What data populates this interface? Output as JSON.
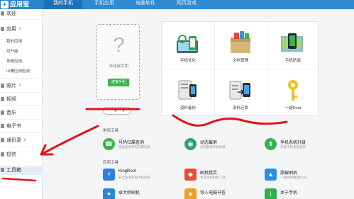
{
  "app": {
    "title": "应用宝"
  },
  "tabs": [
    {
      "label": "我的手机",
      "active": true
    },
    {
      "label": "手机应用",
      "active": false
    },
    {
      "label": "电脑软件",
      "active": false
    },
    {
      "label": "网页游戏",
      "active": false
    }
  ],
  "sidebar": {
    "welcome": "欢迎",
    "apps": {
      "label": "应用",
      "arrow": "∨",
      "subs": [
        "我的应用",
        "可升级",
        "系统应用",
        "山寨应用检测"
      ]
    },
    "photos": {
      "label": "照片",
      "arrow": "∨"
    },
    "video": {
      "label": "视频"
    },
    "music": {
      "label": "音乐"
    },
    "ebook": {
      "label": "电子书"
    },
    "contacts": {
      "label": "通讯录",
      "arrow": "∨"
    },
    "sms": {
      "label": "短信"
    },
    "toolbox": {
      "label": "工具箱"
    }
  },
  "phone_connect": {
    "icon": "?",
    "text": "未连接手机",
    "button": "连接手机"
  },
  "add_control": {
    "plus": "+",
    "caret": "▾"
  },
  "tools": [
    {
      "label": "手机优化",
      "icon": "phone-optimize-icon"
    },
    {
      "label": "文件管理",
      "icon": "file-manager-icon"
    },
    {
      "label": "手机防盗",
      "icon": "phone-antitheft-icon"
    },
    {
      "label": "资料备份",
      "icon": "data-backup-icon"
    },
    {
      "label": "资料还原",
      "icon": "data-restore-icon"
    },
    {
      "label": "一键Root",
      "icon": "key-root-icon"
    }
  ],
  "common_tools": {
    "title": "常用工具",
    "items": [
      {
        "name": "号码归属查询",
        "desc": "快速查询号码归属信息",
        "color": "#3bb54a",
        "icon": "phone-lookup-icon",
        "glyph": "☎"
      },
      {
        "name": "动态截屏",
        "desc": "实时截取手机屏幕",
        "color": "#2fa36b",
        "icon": "screenshot-icon",
        "glyph": "◉"
      },
      {
        "name": "手机系统升级",
        "desc": "升级手机系统固件",
        "color": "#35b34a",
        "icon": "system-upgrade-icon",
        "glyph": "⬆"
      }
    ]
  },
  "app_tools": {
    "title": "应用工具",
    "items": [
      {
        "name": "KingRoot",
        "desc": "安全快速获取手机权限",
        "color": "#2f7fd9",
        "icon": "kingroot-icon",
        "glyph": "⚡"
      },
      {
        "name": "刷机精灵",
        "desc": "专业手机刷机工具",
        "color": "#e84b3a",
        "icon": "flash-wizard-icon",
        "glyph": "◆"
      },
      {
        "name": "甜椒刷机",
        "desc": "一键刷机精品ROM",
        "color": "#2b8fe0",
        "icon": "tianjiao-icon",
        "glyph": "▲"
      },
      {
        "name": "卓大师刷机",
        "desc": "",
        "color": "#2a87d8",
        "icon": "zhuodashi-icon",
        "glyph": "✦"
      },
      {
        "name": "导入电脑书签",
        "desc": "",
        "color": "#f0a020",
        "icon": "bookmark-import-icon",
        "glyph": "★"
      },
      {
        "name": "关于手机",
        "desc": "",
        "color": "#2bb24c",
        "icon": "about-phone-icon",
        "glyph": "i"
      }
    ]
  }
}
